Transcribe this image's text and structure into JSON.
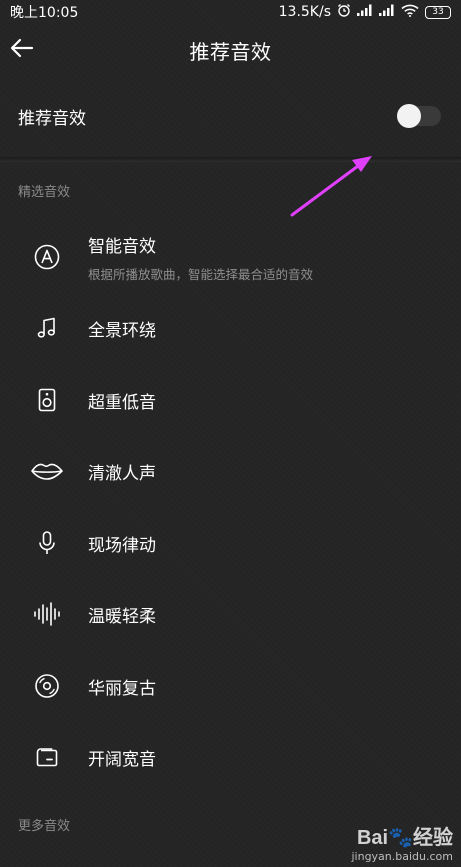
{
  "status_bar": {
    "time": "晚上10:05",
    "network_speed": "13.5K/s",
    "battery": "33",
    "icons": [
      "alarm-icon",
      "signal-icon",
      "signal-icon",
      "wifi-icon",
      "battery-icon"
    ]
  },
  "header": {
    "title": "推荐音效",
    "back_icon": "arrow-left-icon"
  },
  "toggle": {
    "label": "推荐音效",
    "checked": false
  },
  "sections": {
    "featured": "精选音效",
    "more": "更多音效"
  },
  "items": [
    {
      "icon": "letter-a-circle-icon",
      "title": "智能音效",
      "subtitle": "根据所播放歌曲，智能选择最合适的音效"
    },
    {
      "icon": "music-note-icon",
      "title": "全景环绕"
    },
    {
      "icon": "speaker-icon",
      "title": "超重低音"
    },
    {
      "icon": "lips-icon",
      "title": "清澈人声"
    },
    {
      "icon": "microphone-icon",
      "title": "现场律动"
    },
    {
      "icon": "sound-wave-icon",
      "title": "温暖轻柔"
    },
    {
      "icon": "vinyl-record-icon",
      "title": "华丽复古"
    },
    {
      "icon": "wallet-icon",
      "title": "开阔宽音"
    }
  ],
  "watermark": {
    "logo": "Bai🐾经验",
    "url": "jingyan.baidu.com"
  },
  "colors": {
    "background": "#242424",
    "text_primary": "#ffffff",
    "text_secondary": "#8a8a8a",
    "annotation_arrow": "#e040fb"
  }
}
